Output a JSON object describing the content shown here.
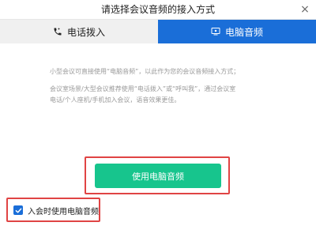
{
  "dialog": {
    "title": "请选择会议音频的接入方式",
    "close_glyph": "×"
  },
  "tabs": [
    {
      "label": "电话拨入",
      "icon": "phone-icon",
      "active": false
    },
    {
      "label": "电脑音频",
      "icon": "computer-icon",
      "active": true
    }
  ],
  "content": {
    "line1": "小型会议可直接使用“电脑音频”，以此作为您的会议音频接入方式；",
    "line2a": "会议室场景/大型会议推荐使用“电话拨入”或“呼叫我”，通过会议室",
    "line2b": "电话/个人座机/手机加入会议，语音效果更佳。"
  },
  "primary_button": {
    "label": "使用电脑音频"
  },
  "checkbox": {
    "label": "入会时使用电脑音频",
    "checked": true
  },
  "colors": {
    "accent": "#1a6ed8",
    "button": "#17c58d",
    "highlight": "#e04444"
  }
}
